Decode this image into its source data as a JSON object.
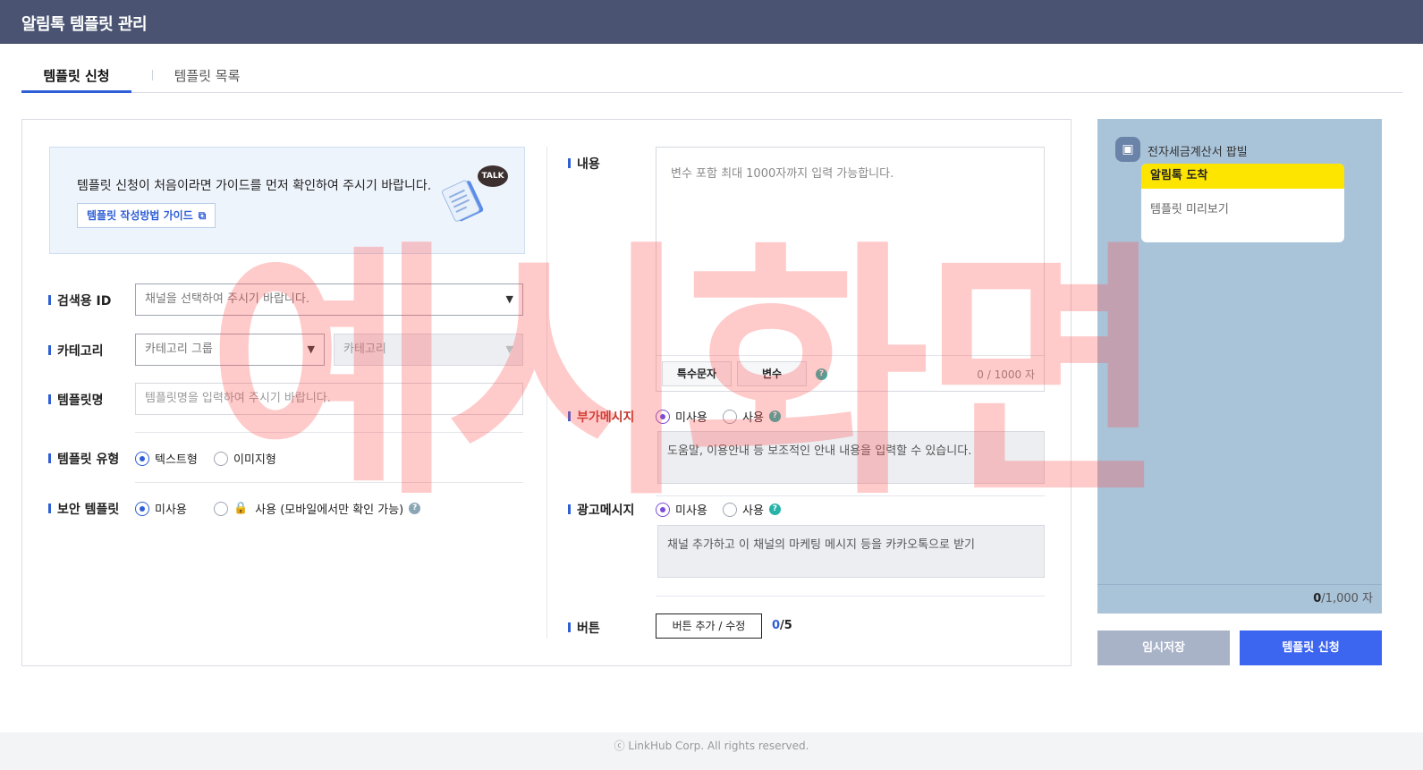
{
  "header": {
    "title": "알림톡 템플릿 관리"
  },
  "tabs": [
    {
      "label": "템플릿 신청",
      "active": true
    },
    {
      "label": "템플릿 목록",
      "active": false
    }
  ],
  "guide": {
    "text": "템플릿 신청이 처음이라면 가이드를 먼저 확인하여 주시기 바랍니다.",
    "button_label": "템플릿 작성방법 가이드",
    "talk_badge": "TALK"
  },
  "form": {
    "search_id": {
      "label": "검색용 ID",
      "placeholder": "채널을 선택하여 주시기 바랍니다."
    },
    "category": {
      "label": "카테고리",
      "group_placeholder": "카테고리 그룹",
      "category_placeholder": "카테고리"
    },
    "template_name": {
      "label": "템플릿명",
      "placeholder": "템플릿명을 입력하여 주시기 바랍니다."
    },
    "template_type": {
      "label": "템플릿 유형",
      "options": [
        "텍스트형",
        "이미지형"
      ],
      "selected": "텍스트형"
    },
    "security": {
      "label": "보안 템플릿",
      "options": [
        "미사용",
        "사용 (모바일에서만 확인 가능)"
      ],
      "selected": "미사용"
    },
    "content": {
      "label": "내용",
      "placeholder": "변수 포함 최대 1000자까지 입력 가능합니다.",
      "special_chars_label": "특수문자",
      "variable_label": "변수",
      "counter": "0 / 1000 자"
    },
    "extra_message": {
      "label": "부가메시지",
      "options": [
        "미사용",
        "사용"
      ],
      "selected": "미사용",
      "text": "도움말, 이용안내 등 보조적인 안내 내용을 입력할 수 있습니다."
    },
    "ad_message": {
      "label": "광고메시지",
      "options": [
        "미사용",
        "사용"
      ],
      "selected": "미사용",
      "text": "채널 추가하고 이 채널의 마케팅 메시지 등을 카카오톡으로 받기"
    },
    "buttons": {
      "label": "버튼",
      "edit_label": "버튼 추가 / 수정",
      "count": "0",
      "max": "/5"
    }
  },
  "preview": {
    "channel_name": "전자세금계산서 팝빌",
    "bubble_header": "알림톡 도착",
    "bubble_body": "템플릿 미리보기",
    "count": "0",
    "count_suffix": "/1,000 자"
  },
  "actions": {
    "save_label": "임시저장",
    "submit_label": "템플릿 신청"
  },
  "footer": {
    "text": "ⓒ LinkHub Corp. All rights reserved."
  },
  "watermark": {
    "text": "예시화면"
  },
  "colors": {
    "header_bg": "#4a5472",
    "accent": "#2f5fd6",
    "submit": "#3d66f0",
    "preview_bg": "#a9c3d9",
    "kakao_yellow": "#fee500"
  }
}
